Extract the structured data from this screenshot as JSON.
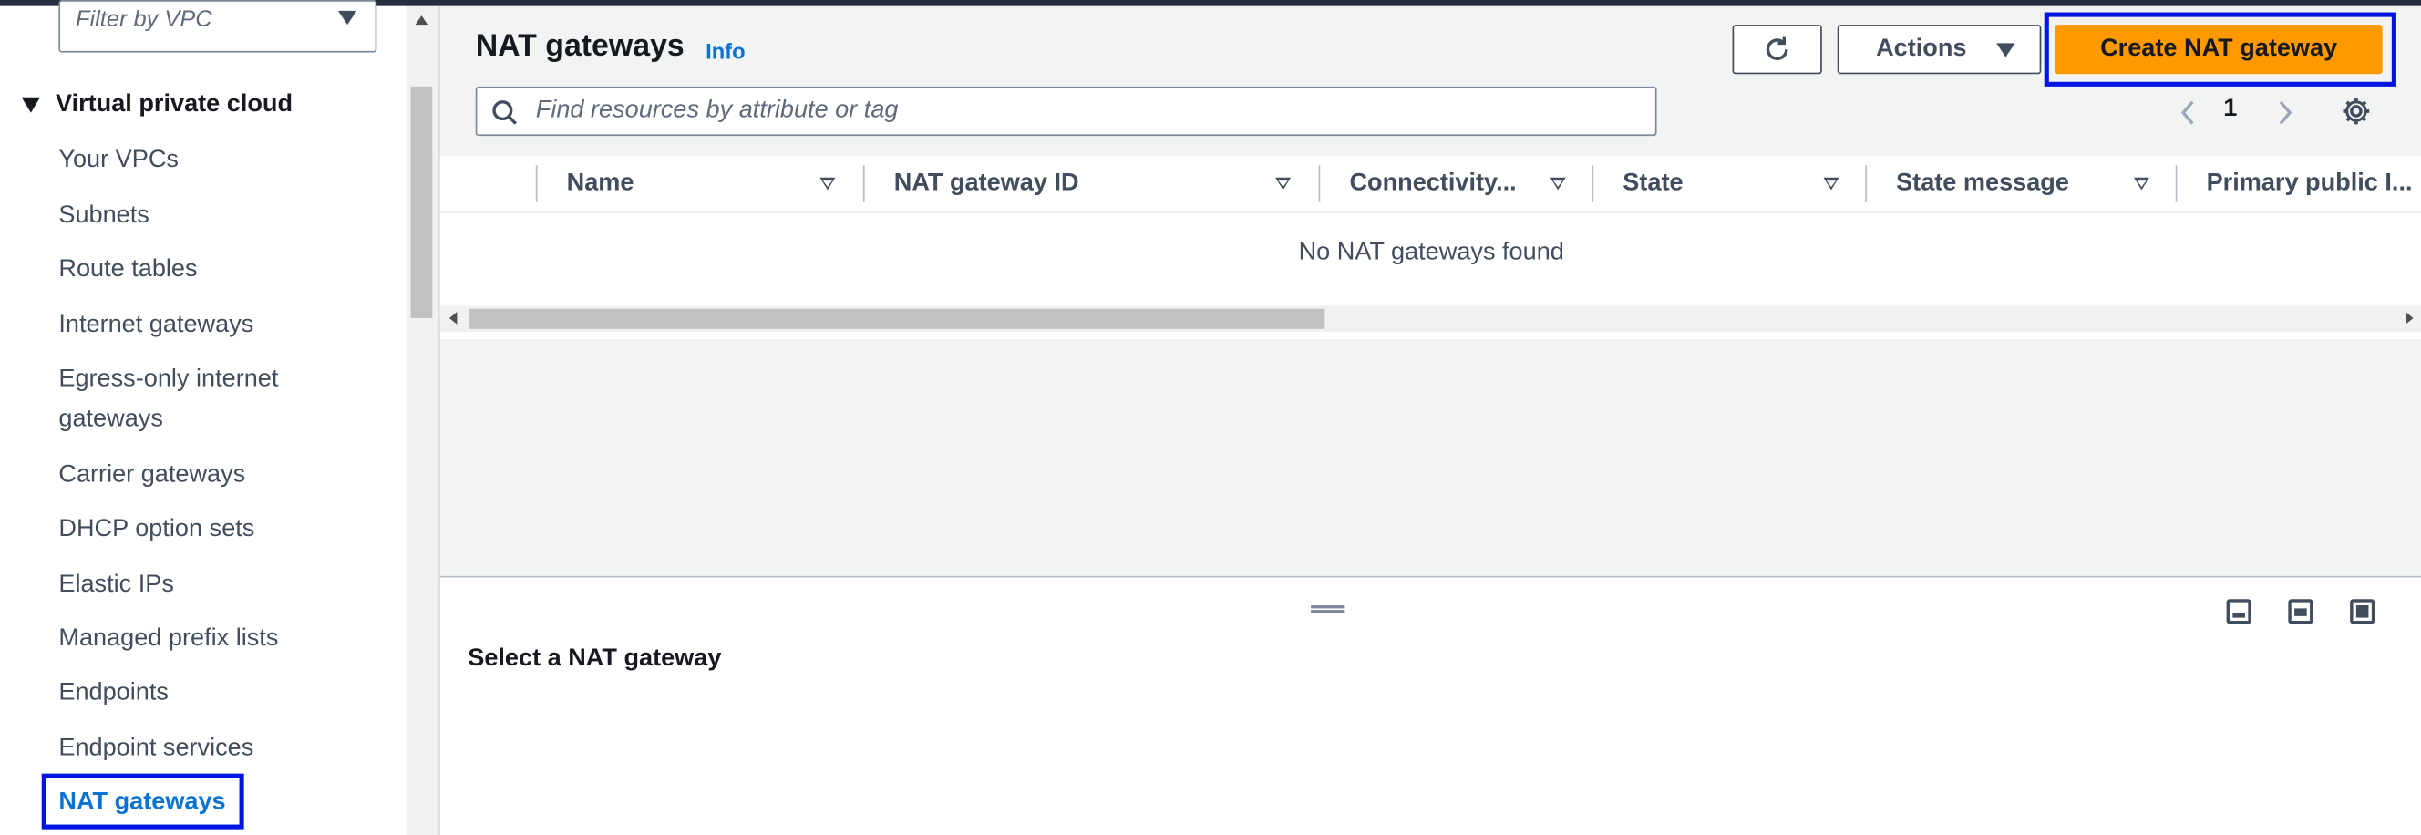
{
  "sidebar": {
    "filter_placeholder": "Filter by VPC",
    "section_label": "Virtual private cloud",
    "items": [
      {
        "label": "Your VPCs"
      },
      {
        "label": "Subnets"
      },
      {
        "label": "Route tables"
      },
      {
        "label": "Internet gateways"
      },
      {
        "label": "Egress-only internet gateways"
      },
      {
        "label": "Carrier gateways"
      },
      {
        "label": "DHCP option sets"
      },
      {
        "label": "Elastic IPs"
      },
      {
        "label": "Managed prefix lists"
      },
      {
        "label": "Endpoints"
      },
      {
        "label": "Endpoint services"
      },
      {
        "label": "NAT gateways",
        "active": true
      }
    ]
  },
  "header": {
    "title": "NAT gateways",
    "info_label": "Info",
    "actions_label": "Actions",
    "create_label": "Create NAT gateway"
  },
  "search": {
    "placeholder": "Find resources by attribute or tag"
  },
  "pagination": {
    "current_page": "1"
  },
  "table": {
    "columns": [
      "Name",
      "NAT gateway ID",
      "Connectivity...",
      "State",
      "State message",
      "Primary public I..."
    ],
    "empty_message": "No NAT gateways found"
  },
  "split_panel": {
    "title": "Select a NAT gateway"
  },
  "colors": {
    "primary_button": "#ff9900",
    "link": "#0972d3",
    "highlight": "#0016e0"
  }
}
